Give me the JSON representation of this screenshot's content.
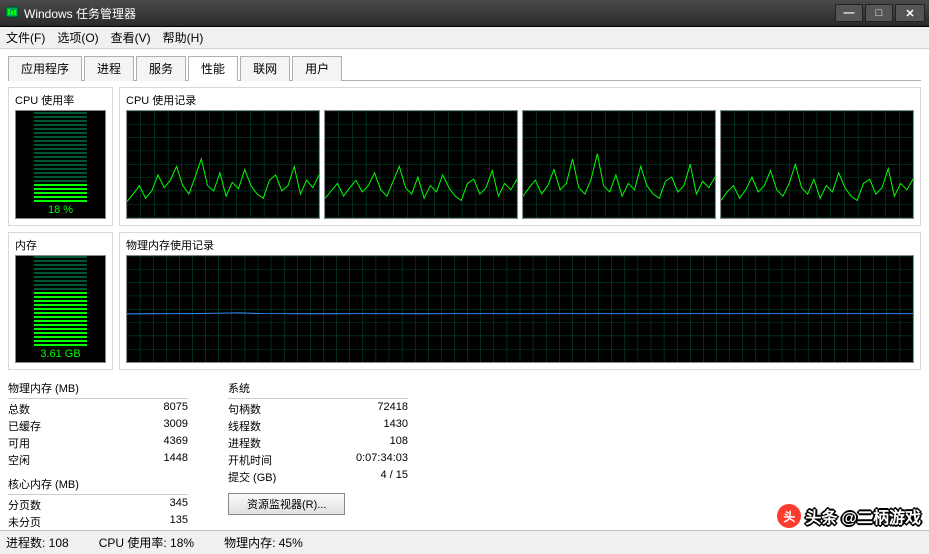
{
  "window": {
    "title": "Windows 任务管理器"
  },
  "menu": {
    "file": "文件(F)",
    "options": "选项(O)",
    "view": "查看(V)",
    "help": "帮助(H)"
  },
  "tabs": {
    "apps": "应用程序",
    "processes": "进程",
    "services": "服务",
    "performance": "性能",
    "networking": "联网",
    "users": "用户"
  },
  "labels": {
    "cpu_usage": "CPU 使用率",
    "cpu_history": "CPU 使用记录",
    "memory": "内存",
    "phys_mem_history": "物理内存使用记录",
    "phys_mem": "物理内存 (MB)",
    "total": "总数",
    "cached": "已缓存",
    "available": "可用",
    "free": "空闲",
    "kernel_mem": "核心内存 (MB)",
    "paged": "分页数",
    "nonpaged": "未分页",
    "system": "系统",
    "handles": "句柄数",
    "threads": "线程数",
    "processes": "进程数",
    "uptime": "开机时间",
    "commit": "提交 (GB)",
    "res_monitor": "资源监视器(R)..."
  },
  "values": {
    "cpu_pct": "18 %",
    "mem_gb": "3.61 GB",
    "total": "8075",
    "cached": "3009",
    "available": "4369",
    "free": "1448",
    "paged": "345",
    "nonpaged": "135",
    "handles": "72418",
    "threads": "1430",
    "processes": "108",
    "uptime": "0:07:34:03",
    "commit": "4 / 15"
  },
  "status": {
    "processes": "进程数: 108",
    "cpu": "CPU 使用率: 18%",
    "memory": "物理内存: 45%"
  },
  "watermark": {
    "prefix": "头条",
    "text": "@二柄游戏"
  },
  "chart_data": {
    "cpu_gauge": {
      "type": "bar",
      "value": 18,
      "max": 100,
      "label": "18 %"
    },
    "mem_gauge": {
      "type": "bar",
      "value": 3.61,
      "max": 8.0,
      "label": "3.61 GB"
    },
    "cpu_history": {
      "type": "line",
      "cores": 4,
      "ylim": [
        0,
        100
      ],
      "note": "per-core CPU % over time, jagged 10-50% with peaks ~70%",
      "series": [
        {
          "name": "core0",
          "values": [
            15,
            22,
            30,
            18,
            25,
            40,
            28,
            35,
            48,
            30,
            22,
            38,
            55,
            30,
            25,
            42,
            20,
            33,
            27,
            45,
            30,
            22,
            18,
            35,
            40,
            25,
            30,
            48,
            22,
            35,
            28,
            40
          ]
        },
        {
          "name": "core1",
          "values": [
            18,
            25,
            32,
            20,
            28,
            35,
            24,
            30,
            42,
            26,
            20,
            34,
            48,
            28,
            22,
            38,
            18,
            30,
            24,
            40,
            28,
            20,
            16,
            32,
            36,
            22,
            28,
            44,
            20,
            32,
            26,
            36
          ]
        },
        {
          "name": "core2",
          "values": [
            20,
            28,
            35,
            22,
            30,
            45,
            26,
            32,
            55,
            28,
            22,
            36,
            60,
            30,
            24,
            40,
            20,
            32,
            26,
            48,
            30,
            22,
            18,
            34,
            38,
            24,
            30,
            50,
            22,
            34,
            28,
            38
          ]
        },
        {
          "name": "core3",
          "values": [
            16,
            24,
            30,
            18,
            26,
            38,
            24,
            30,
            44,
            26,
            20,
            32,
            50,
            28,
            22,
            36,
            18,
            30,
            24,
            42,
            28,
            20,
            16,
            32,
            36,
            22,
            28,
            46,
            20,
            32,
            26,
            36
          ]
        }
      ]
    },
    "mem_history": {
      "type": "line",
      "ylim": [
        0,
        8075
      ],
      "note": "physical memory MB over time, roughly flat near 3700 MB (~45%)",
      "values": [
        3690,
        3695,
        3700,
        3705,
        3740,
        3760,
        3710,
        3700,
        3695,
        3698,
        3700,
        3702,
        3700,
        3698,
        3700,
        3700,
        3700,
        3700,
        3700,
        3700,
        3700,
        3700,
        3700,
        3700,
        3700,
        3700,
        3700,
        3700,
        3700,
        3700,
        3700,
        3700,
        3700,
        3700,
        3700,
        3700
      ]
    }
  }
}
